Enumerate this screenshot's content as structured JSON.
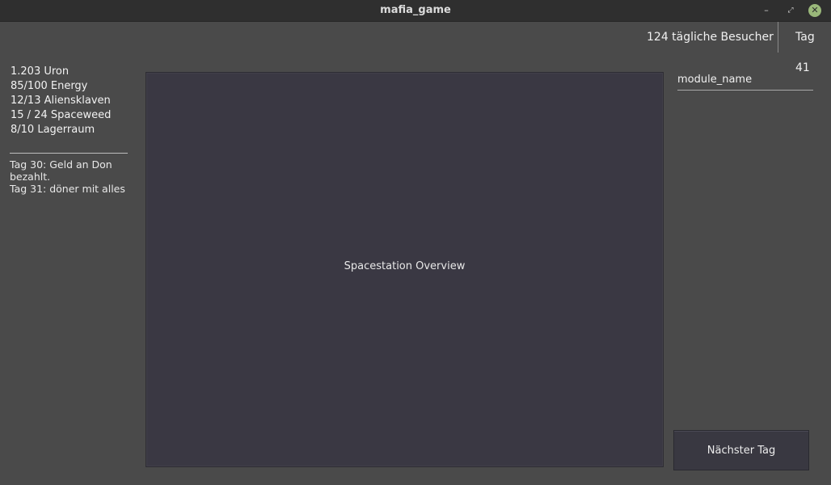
{
  "window": {
    "title": "mafia_game",
    "controls": {
      "minimize": "–",
      "maximize": "⤢",
      "close": "✕"
    }
  },
  "header": {
    "visitors": "124 tägliche Besucher",
    "day": "Tag 41"
  },
  "stats": [
    "1.203 Uron",
    "85/100 Energy",
    "12/13 Aliensklaven",
    "15 / 24 Spaceweed",
    "8/10 Lagerraum"
  ],
  "log": [
    "Tag 30: Geld an Don bezahlt.",
    "Tag 31: döner mit alles"
  ],
  "viewport": {
    "label": "Spacestation Overview"
  },
  "module": {
    "name": "module_name"
  },
  "actions": {
    "next_day": "Nächster Tag"
  }
}
